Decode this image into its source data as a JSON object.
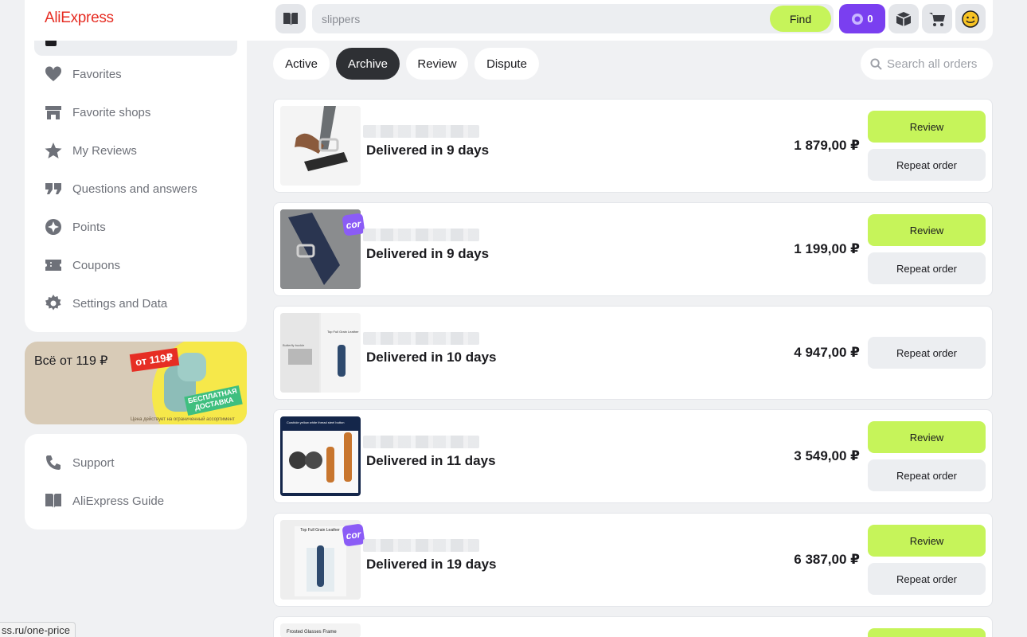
{
  "header": {
    "logo": "AliExpress",
    "search": {
      "value": "slippers",
      "button": "Find"
    },
    "points_count": "0"
  },
  "sidebar": {
    "items": [
      {
        "label": "Favorites",
        "icon": "heart-icon"
      },
      {
        "label": "Favorite shops",
        "icon": "shop-icon"
      },
      {
        "label": "My Reviews",
        "icon": "star-icon"
      },
      {
        "label": "Questions and answers",
        "icon": "quote-icon"
      },
      {
        "label": "Points",
        "icon": "coin-icon"
      },
      {
        "label": "Coupons",
        "icon": "ticket-icon"
      },
      {
        "label": "Settings and Data",
        "icon": "gear-icon"
      }
    ],
    "promo": {
      "title": "Всё от 119 ₽",
      "price_tag": "от 119₽",
      "badge": "БЕСПЛАТНАЯ ДОСТАВКА",
      "note": "Цена действует на ограниченный ассортимент"
    },
    "support_items": [
      {
        "label": "Support",
        "icon": "phone-icon"
      },
      {
        "label": "AliExpress Guide",
        "icon": "book-icon"
      }
    ]
  },
  "tabs": [
    {
      "label": "Active",
      "active": false
    },
    {
      "label": "Archive",
      "active": true
    },
    {
      "label": "Review",
      "active": false
    },
    {
      "label": "Dispute",
      "active": false
    }
  ],
  "order_search_placeholder": "Search all orders",
  "orders": [
    {
      "status": "Delivered in 9 days",
      "price": "1 879,00 ₽",
      "review": "Review",
      "repeat": "Repeat order",
      "has_review": true,
      "badge": ""
    },
    {
      "status": "Delivered in 9 days",
      "price": "1 199,00 ₽",
      "review": "Review",
      "repeat": "Repeat order",
      "has_review": true,
      "badge": "cor"
    },
    {
      "status": "Delivered in 10 days",
      "price": "4 947,00 ₽",
      "review": "",
      "repeat": "Repeat order",
      "has_review": false,
      "badge": "",
      "thumb_texts": [
        "Top Full Grain Leather",
        "Butterfly buckle"
      ]
    },
    {
      "status": "Delivered in 11 days",
      "price": "3 549,00 ₽",
      "review": "Review",
      "repeat": "Repeat order",
      "has_review": true,
      "badge": "",
      "thumb_texts": [
        "Cowhide yellow white thread steel button"
      ]
    },
    {
      "status": "Delivered in 19 days",
      "price": "6 387,00 ₽",
      "review": "Review",
      "repeat": "Repeat order",
      "has_review": true,
      "badge": "cor",
      "thumb_texts": [
        "Top Full Grain Leather"
      ]
    },
    {
      "thumb_texts": [
        "Frosted Glasses Frame"
      ]
    }
  ],
  "status_bar_url": "ss.ru/one-price",
  "colors": {
    "brand": "#e62e24",
    "accent_green": "#c6f45a",
    "points_purple": "#7a3ff0"
  }
}
